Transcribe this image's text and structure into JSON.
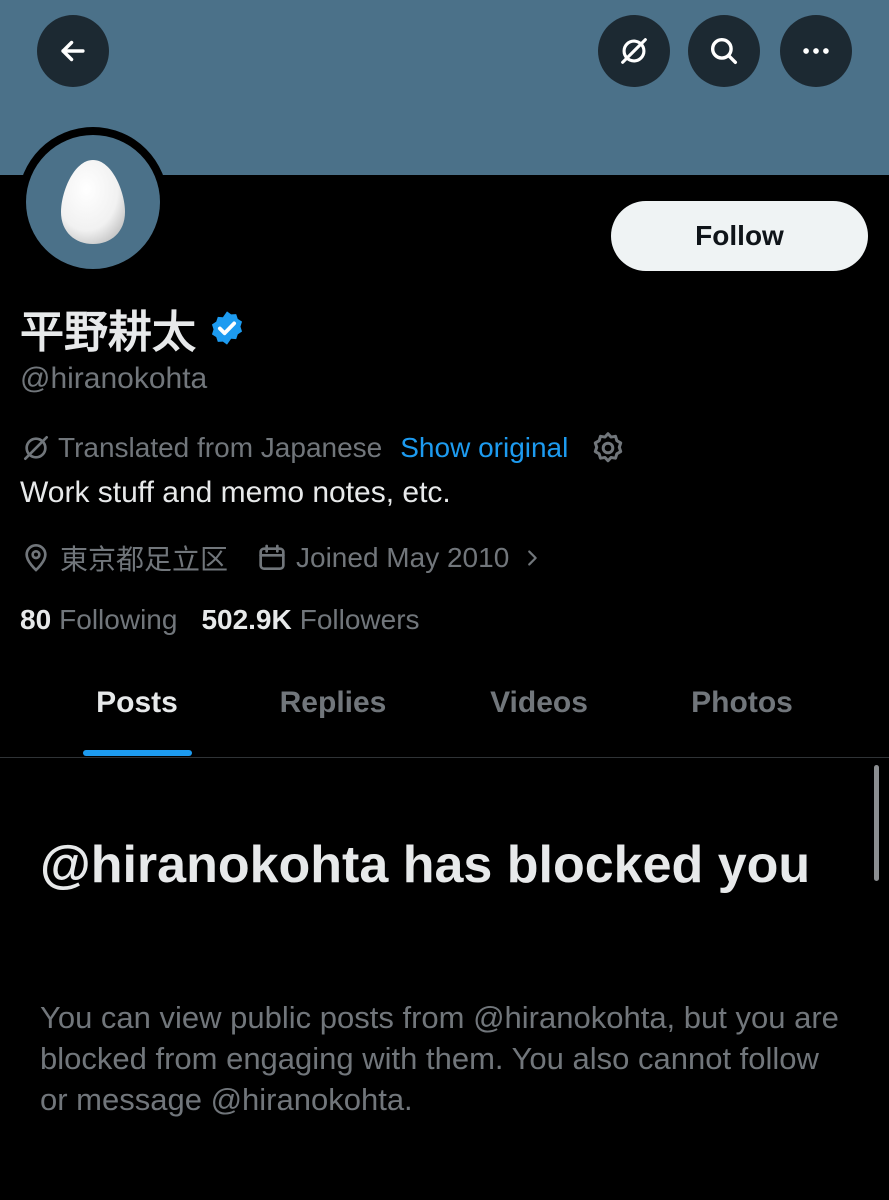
{
  "profile": {
    "display_name": "平野耕太",
    "handle": "@hiranokohta",
    "verified": true,
    "bio": "Work stuff and memo notes, etc.",
    "location": "東京都足立区",
    "joined": "Joined May 2010",
    "following_count": "80",
    "following_label": "Following",
    "followers_count": "502.9K",
    "followers_label": "Followers"
  },
  "translation": {
    "note": "Translated from Japanese",
    "show_original": "Show original"
  },
  "header": {
    "follow_label": "Follow",
    "icons": [
      "back-arrow-icon",
      "grok-icon",
      "search-icon",
      "more-icon"
    ]
  },
  "tabs": [
    {
      "label": "Posts",
      "active": true
    },
    {
      "label": "Replies",
      "active": false
    },
    {
      "label": "Videos",
      "active": false
    },
    {
      "label": "Photos",
      "active": false
    }
  ],
  "blocked": {
    "title": "@hiranokohta has blocked you",
    "description": "You can view public posts from @hiranokohta, but you are blocked from engaging with them. You also cannot follow or message @hiranokohta."
  },
  "colors": {
    "banner": "#4b7189",
    "accent": "#1d9bf0",
    "background": "#000000",
    "muted_text": "#71767b"
  }
}
